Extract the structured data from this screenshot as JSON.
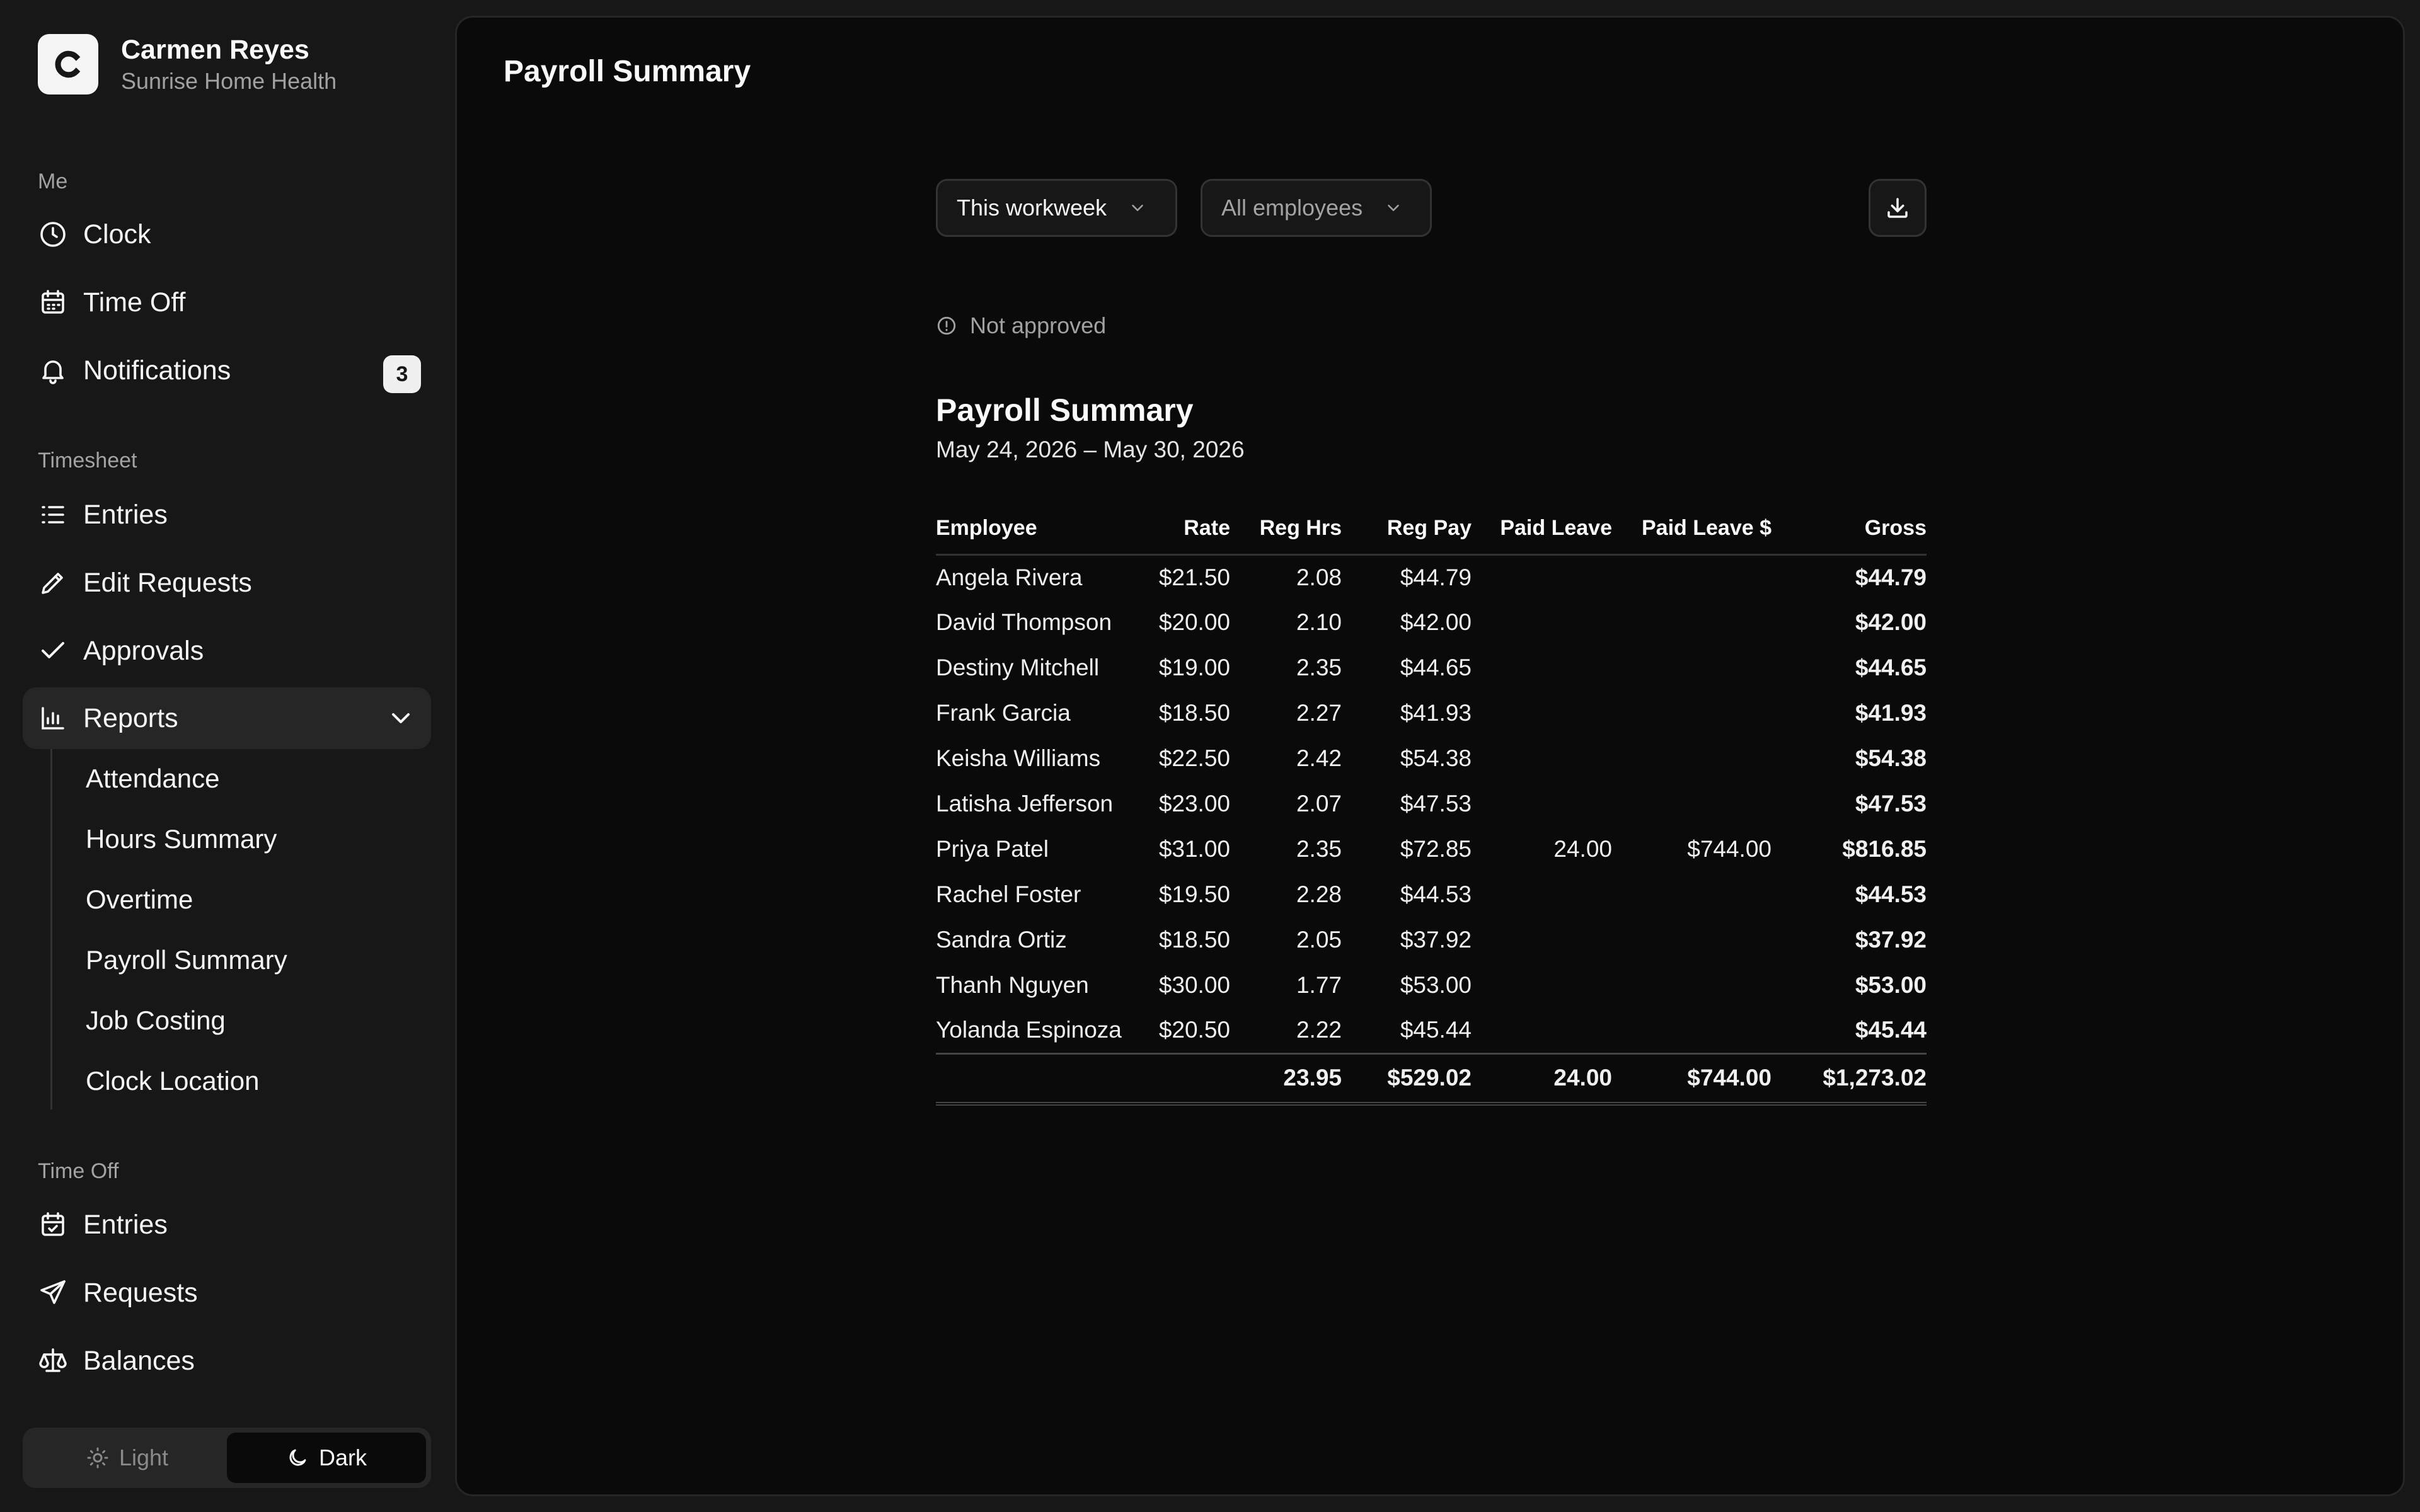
{
  "user": {
    "name": "Carmen Reyes",
    "org": "Sunrise Home Health",
    "logo_letter": "C"
  },
  "sidebar": {
    "me_label": "Me",
    "me_items": [
      {
        "label": "Clock",
        "icon": "clock-icon"
      },
      {
        "label": "Time Off",
        "icon": "calendar-icon"
      },
      {
        "label": "Notifications",
        "icon": "bell-icon",
        "badge": "3"
      }
    ],
    "timesheet_label": "Timesheet",
    "timesheet_items": [
      {
        "label": "Entries",
        "icon": "list-icon"
      },
      {
        "label": "Edit Requests",
        "icon": "pencil-icon"
      },
      {
        "label": "Approvals",
        "icon": "check-icon"
      },
      {
        "label": "Reports",
        "icon": "bar-chart-icon",
        "expanded": true
      }
    ],
    "reports_sub": [
      "Attendance",
      "Hours Summary",
      "Overtime",
      "Payroll Summary",
      "Job Costing",
      "Clock Location"
    ],
    "timeoff_label": "Time Off",
    "timeoff_items": [
      {
        "label": "Entries",
        "icon": "calendar-check-icon"
      },
      {
        "label": "Requests",
        "icon": "send-icon"
      },
      {
        "label": "Balances",
        "icon": "scale-icon"
      }
    ],
    "theme": {
      "light": "Light",
      "dark": "Dark",
      "selected": "Dark"
    }
  },
  "main": {
    "title": "Payroll Summary",
    "filters": {
      "period": "This workweek",
      "employees": "All employees"
    },
    "status": "Not approved",
    "report": {
      "title": "Payroll Summary",
      "range": "May 24, 2026 – May 30, 2026",
      "columns": [
        "Employee",
        "Rate",
        "Reg Hrs",
        "Reg Pay",
        "Paid Leave",
        "Paid Leave $",
        "Gross"
      ],
      "rows": [
        [
          "Angela Rivera",
          "$21.50",
          "2.08",
          "$44.79",
          "",
          "",
          "$44.79"
        ],
        [
          "David Thompson",
          "$20.00",
          "2.10",
          "$42.00",
          "",
          "",
          "$42.00"
        ],
        [
          "Destiny Mitchell",
          "$19.00",
          "2.35",
          "$44.65",
          "",
          "",
          "$44.65"
        ],
        [
          "Frank Garcia",
          "$18.50",
          "2.27",
          "$41.93",
          "",
          "",
          "$41.93"
        ],
        [
          "Keisha Williams",
          "$22.50",
          "2.42",
          "$54.38",
          "",
          "",
          "$54.38"
        ],
        [
          "Latisha Jefferson",
          "$23.00",
          "2.07",
          "$47.53",
          "",
          "",
          "$47.53"
        ],
        [
          "Priya Patel",
          "$31.00",
          "2.35",
          "$72.85",
          "24.00",
          "$744.00",
          "$816.85"
        ],
        [
          "Rachel Foster",
          "$19.50",
          "2.28",
          "$44.53",
          "",
          "",
          "$44.53"
        ],
        [
          "Sandra Ortiz",
          "$18.50",
          "2.05",
          "$37.92",
          "",
          "",
          "$37.92"
        ],
        [
          "Thanh Nguyen",
          "$30.00",
          "1.77",
          "$53.00",
          "",
          "",
          "$53.00"
        ],
        [
          "Yolanda Espinoza",
          "$20.50",
          "2.22",
          "$45.44",
          "",
          "",
          "$45.44"
        ]
      ],
      "totals": [
        "",
        "",
        "23.95",
        "$529.02",
        "24.00",
        "$744.00",
        "$1,273.02"
      ]
    }
  }
}
